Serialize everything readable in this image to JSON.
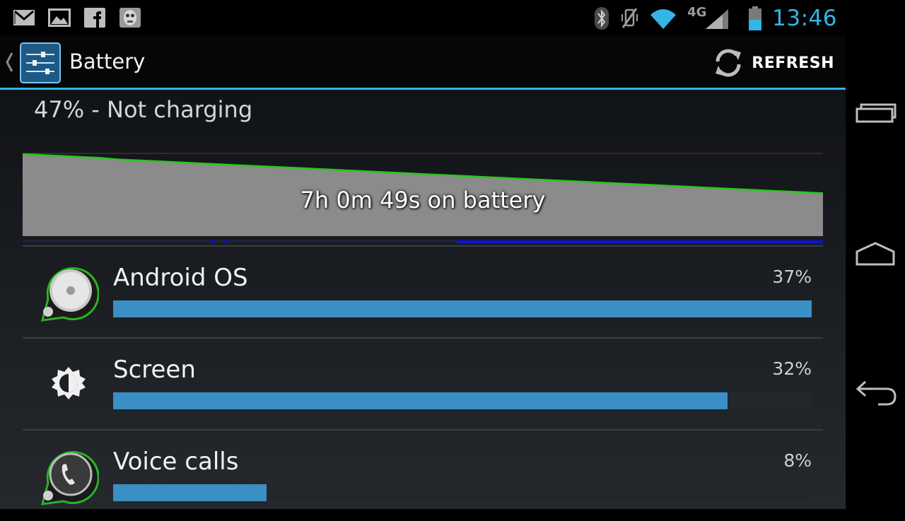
{
  "status_bar": {
    "notification_icons": [
      "gmail-icon",
      "gallery-icon",
      "facebook-icon",
      "app-icon"
    ],
    "system_icons": [
      "bluetooth-icon",
      "vibrate-off-icon",
      "wifi-icon",
      "4g-lte-icon",
      "signal-icon",
      "battery-icon"
    ],
    "network_label": "4G",
    "clock": "13:46"
  },
  "action_bar": {
    "title": "Battery",
    "refresh_label": "REFRESH"
  },
  "battery": {
    "status": "47% - Not charging",
    "graph_label": "7h 0m 49s on battery",
    "level_history_percent": [
      100,
      99,
      98,
      97,
      96,
      95,
      93,
      92,
      91,
      90,
      89,
      88,
      87,
      86,
      85,
      84,
      83,
      82,
      81,
      80,
      79,
      78,
      77,
      76,
      75,
      74,
      73,
      72,
      71,
      70,
      69,
      68,
      67,
      66,
      65,
      64,
      63,
      62,
      61,
      60,
      59,
      58,
      57,
      56,
      55,
      54,
      53,
      52,
      51,
      50,
      49,
      48,
      47
    ]
  },
  "usage": [
    {
      "name": "Android OS",
      "percent_label": "37%",
      "bar_fraction": 1.0,
      "icon": "android-os-icon"
    },
    {
      "name": "Screen",
      "percent_label": "32%",
      "bar_fraction": 0.88,
      "icon": "brightness-icon"
    },
    {
      "name": "Voice calls",
      "percent_label": "8%",
      "bar_fraction": 0.22,
      "icon": "phone-icon"
    }
  ],
  "colors": {
    "accent": "#33b5e5",
    "bar": "#3a8fc4",
    "graph_line": "#27c81b",
    "graph_fill": "#8b8b8b",
    "signal_strip": "#1010d0"
  },
  "nav_bar": [
    "recent-apps-icon",
    "home-icon",
    "back-icon"
  ]
}
